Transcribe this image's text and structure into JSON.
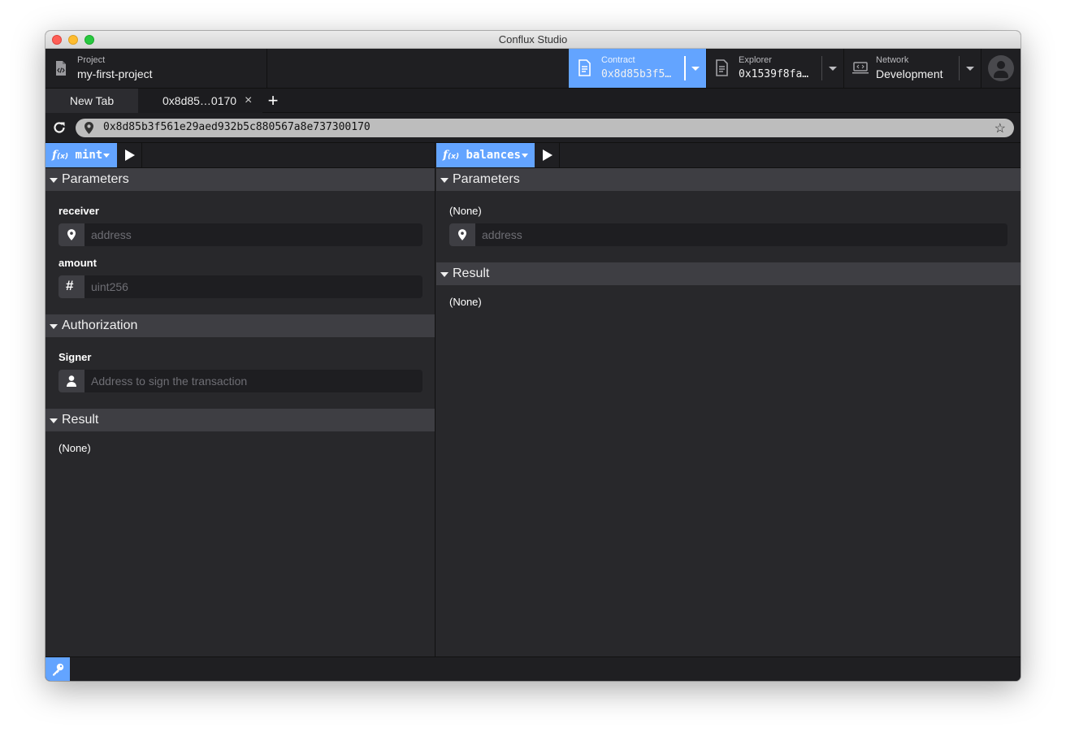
{
  "window": {
    "title": "Conflux Studio"
  },
  "header": {
    "project": {
      "label": "Project",
      "value": "my-first-project"
    },
    "contract": {
      "label": "Contract",
      "value": "0x8d85b3f5…"
    },
    "explorer": {
      "label": "Explorer",
      "value": "0x1539f8fa…"
    },
    "network": {
      "label": "Network",
      "value": "Development"
    }
  },
  "tabs": {
    "new_tab": "New Tab",
    "active": "0x8d85…0170",
    "close": "×",
    "add": "+"
  },
  "address": {
    "value": "0x8d85b3f561e29aed932b5c880567a8e737300170"
  },
  "left_pane": {
    "function": {
      "f": "f",
      "x": "(x)",
      "name": "mint"
    },
    "parameters": {
      "title": "Parameters",
      "fields": [
        {
          "label": "receiver",
          "placeholder": "address",
          "icon": "map-pin-icon"
        },
        {
          "label": "amount",
          "placeholder": "uint256",
          "icon": "hash-icon"
        }
      ]
    },
    "authorization": {
      "title": "Authorization",
      "signer_label": "Signer",
      "signer_placeholder": "Address to sign the transaction"
    },
    "result": {
      "title": "Result",
      "value": "(None)"
    }
  },
  "right_pane": {
    "function": {
      "f": "f",
      "x": "(x)",
      "name": "balances"
    },
    "parameters": {
      "title": "Parameters",
      "note": "(None)",
      "placeholder": "address"
    },
    "result": {
      "title": "Result",
      "value": "(None)"
    }
  },
  "colors": {
    "accent": "#63a4ff",
    "background": "#28282b",
    "section": "#3e3e43"
  }
}
